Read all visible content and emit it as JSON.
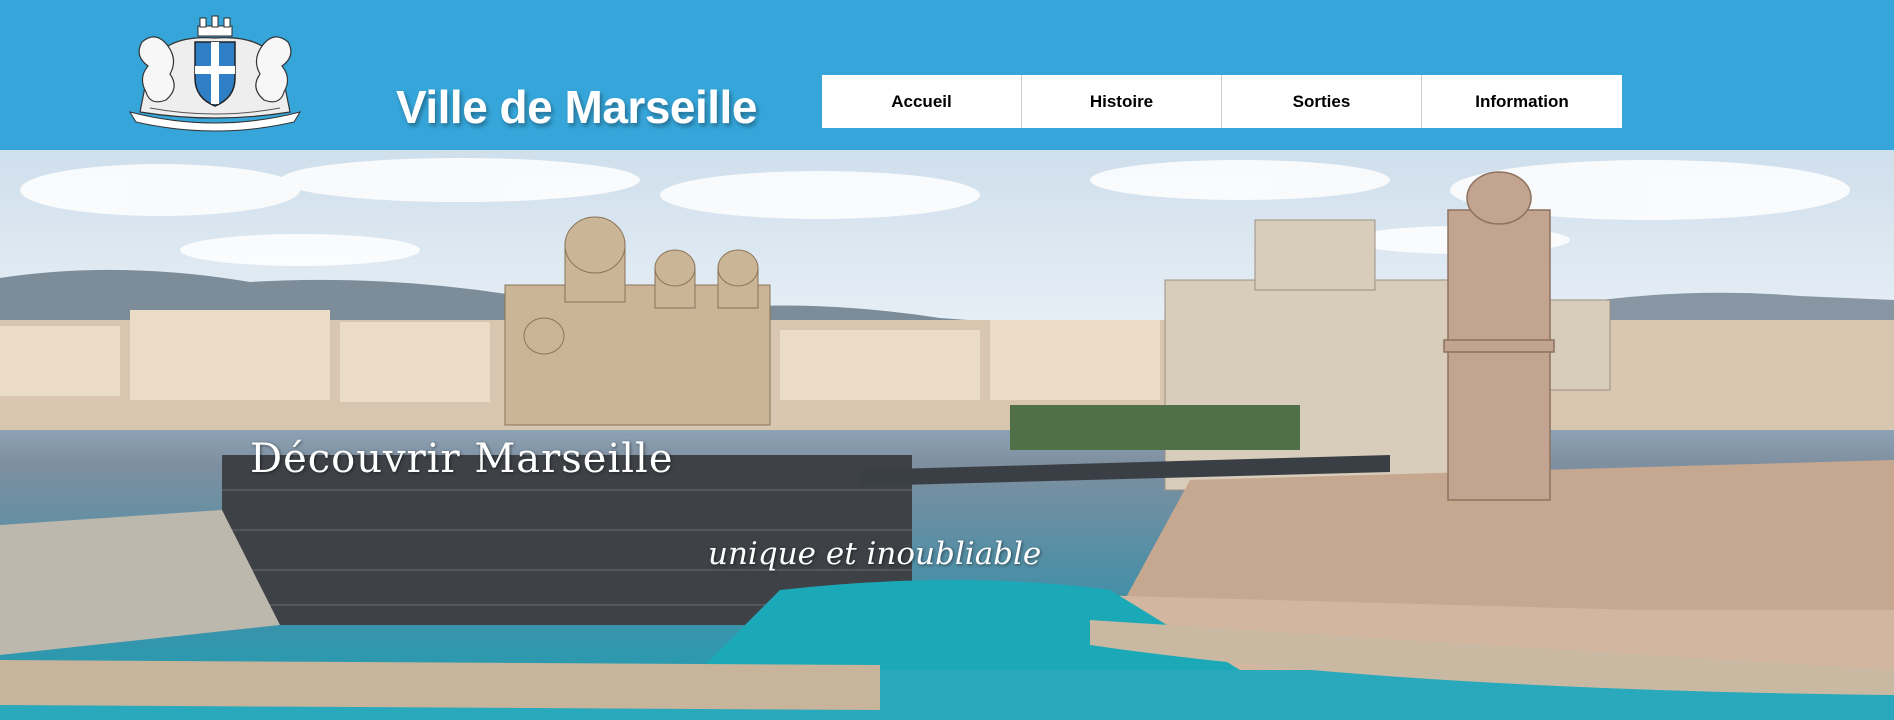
{
  "header": {
    "site_title": "Ville de Marseille",
    "logo_icon": "coat-of-arms-icon",
    "background_color": "#36a6da"
  },
  "nav": {
    "items": [
      {
        "label": "Accueil"
      },
      {
        "label": "Histoire"
      },
      {
        "label": "Sorties"
      },
      {
        "label": "Information"
      }
    ]
  },
  "hero": {
    "title": "Découvrir Marseille",
    "tagline": "unique et inoubliable"
  }
}
